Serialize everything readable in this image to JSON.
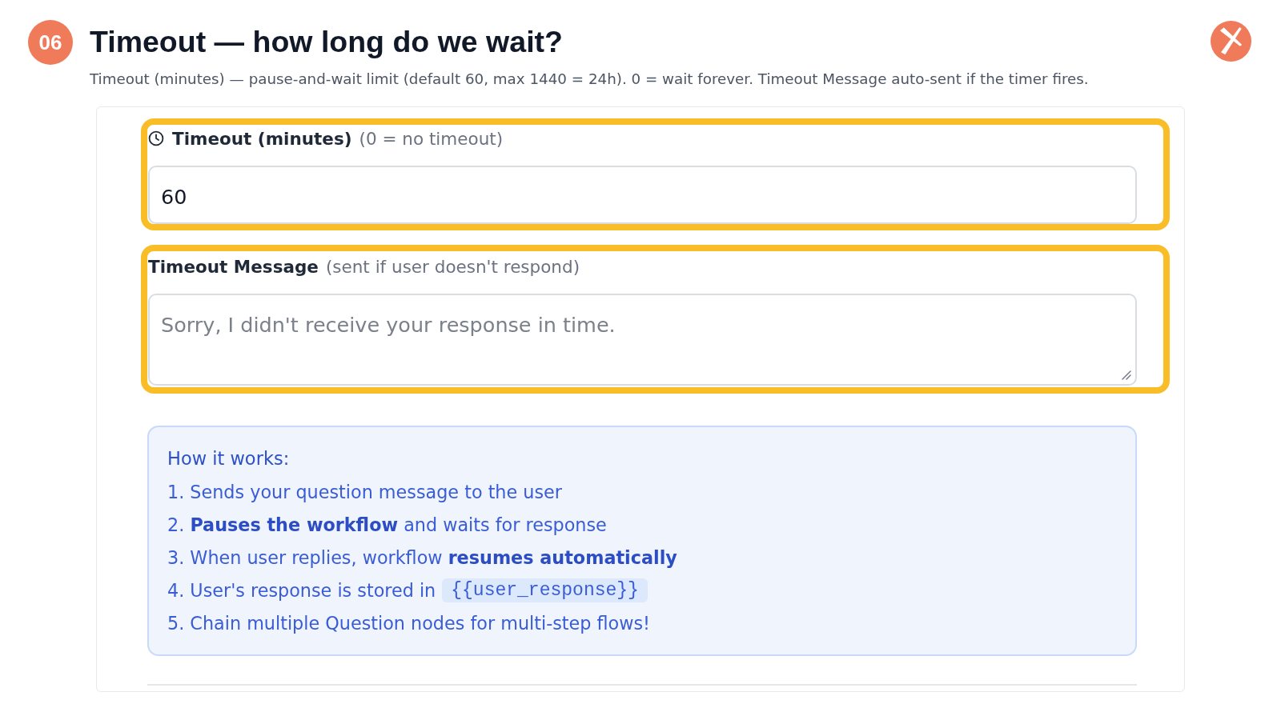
{
  "step": {
    "number": "06",
    "title": "Timeout — how long do we wait?",
    "subtitle": "Timeout (minutes) — pause-and-wait limit (default 60, max 1440 = 24h). 0 = wait forever. Timeout Message auto-sent if the timer fires."
  },
  "fields": [
    {
      "kind": "input",
      "icon": true,
      "label": "Timeout (minutes)",
      "hint": "(0 = no timeout)",
      "value": "60",
      "highlighted": true
    },
    {
      "kind": "textarea",
      "icon": false,
      "label": "Timeout Message",
      "hint": "(sent if user doesn't respond)",
      "placeholder": "Sorry, I didn't receive your response in time.",
      "highlighted": true
    }
  ],
  "info_box": {
    "heading": "How it works:",
    "steps": [
      {
        "text": "1. Sends your question message to the user"
      },
      {
        "text": "2. **Pauses the workflow** and waits for response"
      },
      {
        "text": "3. When user replies, workflow **resumes automatically**"
      },
      {
        "text": "4. User's response is stored in",
        "code": "{{user_response}}"
      },
      {
        "text": "5. Chain multiple Question nodes for multi-step flows!"
      }
    ]
  }
}
